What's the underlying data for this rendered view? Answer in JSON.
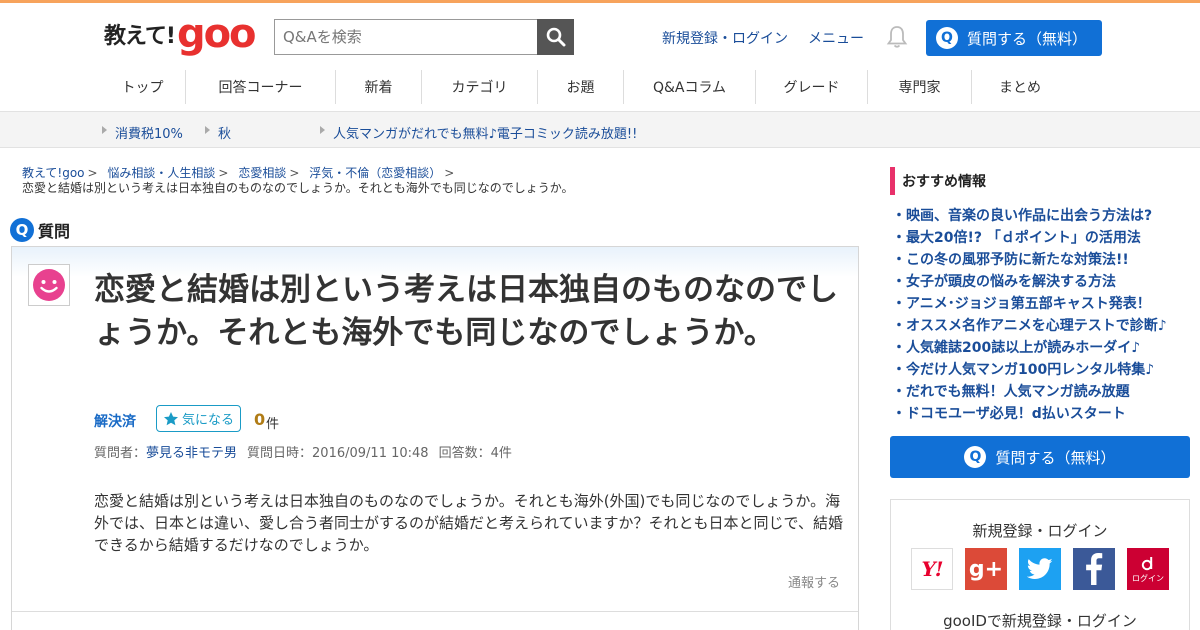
{
  "header": {
    "logo_kana": "教えて!",
    "logo_goo": "goo",
    "search_placeholder": "Q&Aを検索",
    "register_login": "新規登録・ログイン",
    "menu": "メニュー",
    "ask_button": "質問する（無料）"
  },
  "nav": [
    {
      "label": "トップ",
      "w": 86
    },
    {
      "label": "回答コーナー",
      "w": 150
    },
    {
      "label": "新着",
      "w": 86
    },
    {
      "label": "カテゴリ",
      "w": 116
    },
    {
      "label": "お題",
      "w": 86
    },
    {
      "label": "Q&Aコラム",
      "w": 132
    },
    {
      "label": "グレード",
      "w": 112
    },
    {
      "label": "専門家",
      "w": 104
    },
    {
      "label": "まとめ",
      "w": 96
    }
  ],
  "subbar": {
    "links": [
      "消費税10%",
      "秋",
      "人気マンガがだれでも無料♪電子コミック読み放題!!"
    ]
  },
  "breadcrumb": {
    "items": [
      "教えて!goo",
      "悩み相談・人生相談",
      "恋愛相談",
      "浮気・不倫（恋愛相談）"
    ],
    "current": "恋愛と結婚は別という考えは日本独自のものなのでしょうか。それとも海外でも同じなのでしょうか。"
  },
  "question": {
    "label_icon": "Q",
    "label": "質問",
    "title": "恋愛と結婚は別という考えは日本独自のものなのでしょうか。それとも海外でも同じなのでしょうか。",
    "status": "解決済",
    "kininaru": "気になる",
    "count": "0",
    "count_unit": "件",
    "asker_label": "質問者：",
    "asker": "夢見る非モテ男",
    "date": "質問日時：2016/09/11 10:48",
    "answers": "回答数：4件",
    "body": "恋愛と結婚は別という考えは日本独自のものなのでしょうか。それとも海外(外国)でも同じなのでしょうか。海外では、日本とは違い、愛し合う者同士がするのが結婚だと考えられていますか？それとも日本と同じで、結婚できるから結婚するだけなのでしょうか。",
    "report": "通報する"
  },
  "sidebar": {
    "recommend_title": "おすすめ情報",
    "recommend": [
      "映画、音楽の良い作品に出会う方法は?",
      "最大20倍!? 「ｄポイント」の活用法",
      "この冬の風邪予防に新たな対策法!!",
      "女子が頭皮の悩みを解決する方法",
      "アニメ･ジョジョ第五部キャスト発表！",
      "オススメ名作アニメを心理テストで診断♪",
      "人気雑誌200誌以上が読みホーダイ♪",
      "今だけ人気マンガ100円レンタル特集♪",
      "だれでも無料！人気マンガ読み放題",
      "ドコモユーザ必見！d払いスタート"
    ],
    "ask_button": "質問する（無料）",
    "login_title": "新規登録・ログイン",
    "sns": {
      "yahoo": "Y!",
      "google": "g+",
      "docomo_small": "ログイン"
    },
    "goo_login": "gooIDで新規登録・ログイン"
  },
  "colors": {
    "accent_orange": "#f7a35c",
    "brand_red": "#e8312f",
    "primary_blue": "#1170d6",
    "link_blue": "#1a4d99",
    "pink_bar": "#e8316a"
  }
}
